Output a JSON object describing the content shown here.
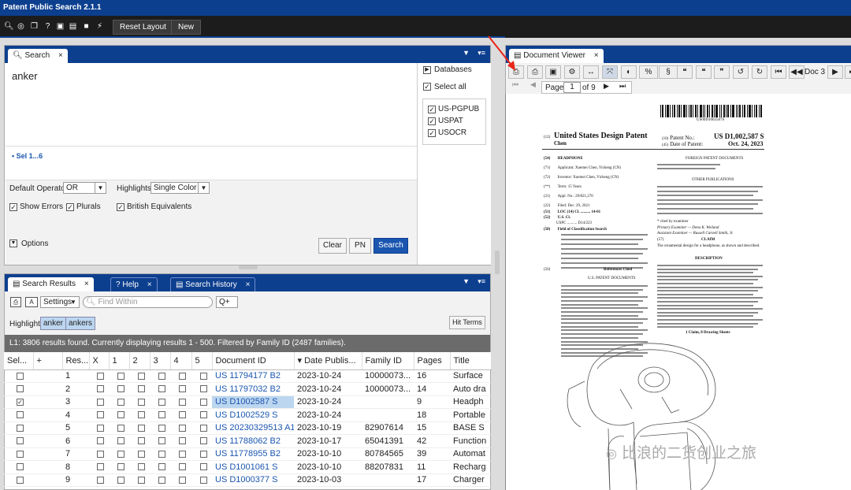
{
  "app": {
    "title": "Patent Public Search 2.1.1"
  },
  "toolbar": {
    "reset_label": "Reset Layout",
    "new_label": "New"
  },
  "search": {
    "tab": "Search",
    "query": "anker",
    "sel_label": "Sel 1...6",
    "databases_label": "Databases",
    "select_all": "Select all",
    "dbs": [
      "US-PGPUB",
      "USPAT",
      "USOCR"
    ],
    "default_operator_label": "Default Operator:",
    "default_operator_value": "OR",
    "highlights_label": "Highlights:",
    "highlights_value": "Single Color",
    "show_errors": "Show Errors",
    "plurals": "Plurals",
    "british": "British Equivalents",
    "options": "Options",
    "clear": "Clear",
    "pn": "PN",
    "search_btn": "Search"
  },
  "results": {
    "tabs": [
      "Search Results",
      "Help",
      "Search History"
    ],
    "settings": "Settings",
    "find_placeholder": "Find Within",
    "highlight_label": "Highlight:",
    "highlight_terms": [
      "anker",
      "ankers"
    ],
    "hit_terms": "Hit Terms",
    "summary": "L1: 3806 results found. Currently displaying results 1 - 500. Filtered by Family ID (2487 families).",
    "columns": [
      "Sel...",
      "+",
      "Res...",
      "X",
      "1",
      "2",
      "3",
      "4",
      "5",
      "Document ID",
      "Date Publis...",
      "Family ID",
      "Pages",
      "Title"
    ],
    "rows": [
      {
        "n": "1",
        "id": "US 11794177 B2",
        "date": "2023-10-24",
        "fam": "10000073...",
        "pages": "16",
        "title": "Surface",
        "sel": false
      },
      {
        "n": "2",
        "id": "US 11797032 B2",
        "date": "2023-10-24",
        "fam": "10000073...",
        "pages": "14",
        "title": "Auto dra",
        "sel": false
      },
      {
        "n": "3",
        "id": "US D1002587 S",
        "date": "2023-10-24",
        "fam": "",
        "pages": "9",
        "title": "Headph",
        "sel": true
      },
      {
        "n": "4",
        "id": "US D1002529 S",
        "date": "2023-10-24",
        "fam": "",
        "pages": "18",
        "title": "Portable",
        "sel": false
      },
      {
        "n": "5",
        "id": "US 20230329513 A1",
        "date": "2023-10-19",
        "fam": "82907614",
        "pages": "15",
        "title": "BASE S",
        "sel": false
      },
      {
        "n": "6",
        "id": "US 11788062 B2",
        "date": "2023-10-17",
        "fam": "65041391",
        "pages": "42",
        "title": "Function",
        "sel": false
      },
      {
        "n": "7",
        "id": "US 11778955 B2",
        "date": "2023-10-10",
        "fam": "80784565",
        "pages": "39",
        "title": "Automat",
        "sel": false
      },
      {
        "n": "8",
        "id": "US D1001061 S",
        "date": "2023-10-10",
        "fam": "88207831",
        "pages": "11",
        "title": "Recharg",
        "sel": false
      },
      {
        "n": "9",
        "id": "US D1000377 S",
        "date": "2023-10-03",
        "fam": "",
        "pages": "17",
        "title": "Charger",
        "sel": false
      }
    ]
  },
  "viewer": {
    "tab": "Document Viewer",
    "doc_label": "Doc 3",
    "page_label": "Page",
    "page_value": "1",
    "of_label": "of 9",
    "zoom_label": "%"
  },
  "patent": {
    "barcode_text": "US00D1002587S",
    "title": "United States Design Patent",
    "inventor_short": "Chen",
    "no_label": "Patent No.:",
    "no_value": "US D1,002,587 S",
    "date_label": "Date of Patent:",
    "date_value": "Oct. 24, 2023",
    "item_title": "HEADPHONE",
    "applicant": "Applicant: Xuemei Chen, Yicheng (CN)",
    "inventor": "Inventor: Xuemei Chen, Yicheng (CN)",
    "term": "Term: 15 Years",
    "appl": "Appl. No.: 29/821,270",
    "filed": "Filed: Dec. 29, 2021",
    "loc": "LOC (14) Cl. .......... 14-01",
    "uscl": "U.S. Cl.",
    "uspc": "USPC .......... D14/223",
    "field": "Field of Classification Search",
    "refs": "References Cited",
    "refs_sub": "U.S. PATENT DOCUMENTS",
    "foreign": "FOREIGN PATENT DOCUMENTS",
    "other": "OTHER PUBLICATIONS",
    "examiner": "Primary Examiner — Dena K. Weiland",
    "asst": "Assistant Examiner — Russell Carnell Smith, Jr.",
    "claim_head": "CLAIM",
    "claim": "The ornamental design for a headphone, as shown and described.",
    "desc_head": "DESCRIPTION",
    "claims_count": "1 Claim, 8 Drawing Sheets",
    "watermark": "比浪的二货创业之旅"
  }
}
